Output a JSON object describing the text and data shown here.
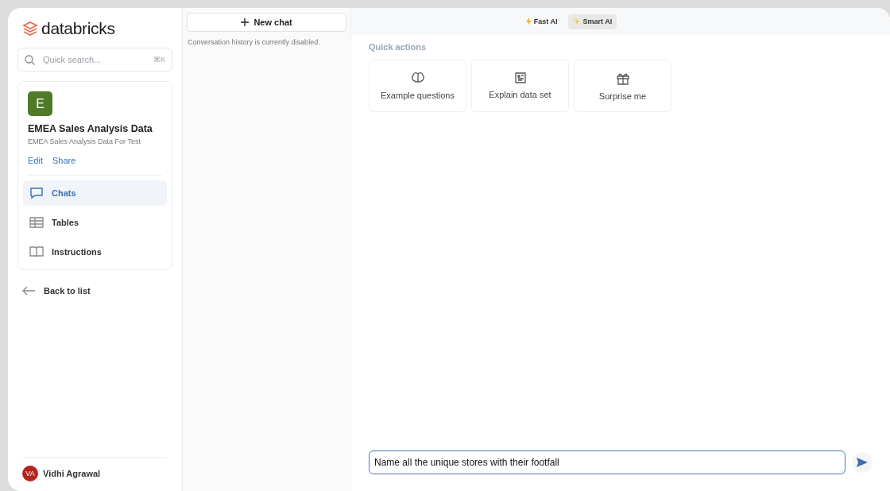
{
  "sidebar": {
    "brand": "databricks",
    "search": {
      "placeholder": "Quick search...",
      "shortcut": "⌘K"
    },
    "space": {
      "avatar": "E",
      "title": "EMEA Sales Analysis Data",
      "subtitle": "EMEA Sales Analysis Data For Test",
      "links": [
        "Edit",
        "Share"
      ]
    },
    "items": [
      {
        "kind": "chats",
        "label": "Chats",
        "selected": true
      },
      {
        "kind": "tables",
        "label": "Tables",
        "selected": false
      },
      {
        "kind": "instructions",
        "label": "Instructions",
        "selected": false
      }
    ],
    "back": "Back to list",
    "user": {
      "initials": "VA",
      "name": "Vidhi Agrawal"
    }
  },
  "history": {
    "new_chat": "New chat",
    "note": "Conversation history is currently disabled."
  },
  "modes": [
    {
      "kind": "fast",
      "label": "Fast AI",
      "selected": false
    },
    {
      "kind": "smart",
      "label": "Smart AI",
      "selected": true
    }
  ],
  "quick_actions": {
    "title": "Quick actions",
    "items": [
      {
        "kind": "brain",
        "label": "Example questions"
      },
      {
        "kind": "document",
        "label": "Explain data set"
      },
      {
        "kind": "gift",
        "label": "Surprise me"
      }
    ]
  },
  "composer": {
    "value": "Name all the unique stores with their footfall"
  }
}
